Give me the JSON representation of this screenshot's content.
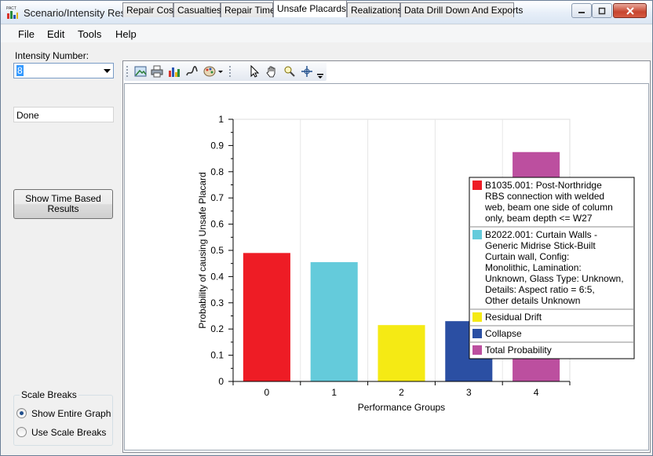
{
  "window": {
    "title": "Scenario/Intensity Results - Unsaved Results",
    "app_icon_text": "PACT"
  },
  "menu": [
    "File",
    "Edit",
    "Tools",
    "Help"
  ],
  "left": {
    "intensity_label": "Intensity Number:",
    "intensity_value": "8",
    "status": "Done",
    "time_button": {
      "line1": "Show Time Based",
      "line2": "Results"
    },
    "scale_breaks": {
      "title": "Scale Breaks",
      "options": [
        {
          "label": "Show Entire Graph",
          "checked": true
        },
        {
          "label": "Use Scale Breaks",
          "checked": false
        }
      ]
    }
  },
  "tabs": [
    {
      "label": "Repair Cost",
      "active": false
    },
    {
      "label": "Casualties",
      "active": false
    },
    {
      "label": "Repair Time",
      "active": false
    },
    {
      "label": "Unsafe Placards",
      "active": true
    },
    {
      "label": "Realizations",
      "active": false
    },
    {
      "label": "Data Drill Down And Exports",
      "active": false
    }
  ],
  "toolbar_icons": [
    "image-icon",
    "print-icon",
    "chart-type-icon",
    "hand-draw-icon",
    "palette-icon",
    "pointer-icon",
    "pan-icon",
    "zoom-icon",
    "crosshair-icon"
  ],
  "chart_data": {
    "type": "bar",
    "categories": [
      "0",
      "1",
      "2",
      "3",
      "4"
    ],
    "values": [
      0.49,
      0.455,
      0.215,
      0.23,
      0.875
    ],
    "colors": [
      "#ee1c25",
      "#64cbdb",
      "#f5ea14",
      "#2b4fa3",
      "#bc4f9f"
    ],
    "xlabel": "Performance Groups",
    "ylabel": "Probability of causing Unsafe Placard",
    "ylim": [
      0,
      1
    ],
    "yticks": [
      "0",
      "0.1",
      "0.2",
      "0.3",
      "0.4",
      "0.5",
      "0.6",
      "0.7",
      "0.8",
      "0.9",
      "1"
    ],
    "legend_position": "right",
    "legend": [
      {
        "color": "#ee1c25",
        "lines": [
          "B1035.001: Post-Northridge",
          "RBS connection with welded",
          "web, beam one side of column",
          "only, beam depth <= W27"
        ]
      },
      {
        "color": "#64cbdb",
        "lines": [
          "B2022.001: Curtain Walls -",
          "Generic Midrise Stick-Built",
          "Curtain wall, Config:",
          "Monolithic, Lamination:",
          "Unknown, Glass Type: Unknown,",
          "Details: Aspect ratio = 6:5,",
          "Other details Unknown"
        ]
      },
      {
        "color": "#f5ea14",
        "lines": [
          "Residual Drift"
        ]
      },
      {
        "color": "#2b4fa3",
        "lines": [
          "Collapse"
        ]
      },
      {
        "color": "#bc4f9f",
        "lines": [
          "Total Probability"
        ]
      }
    ]
  }
}
